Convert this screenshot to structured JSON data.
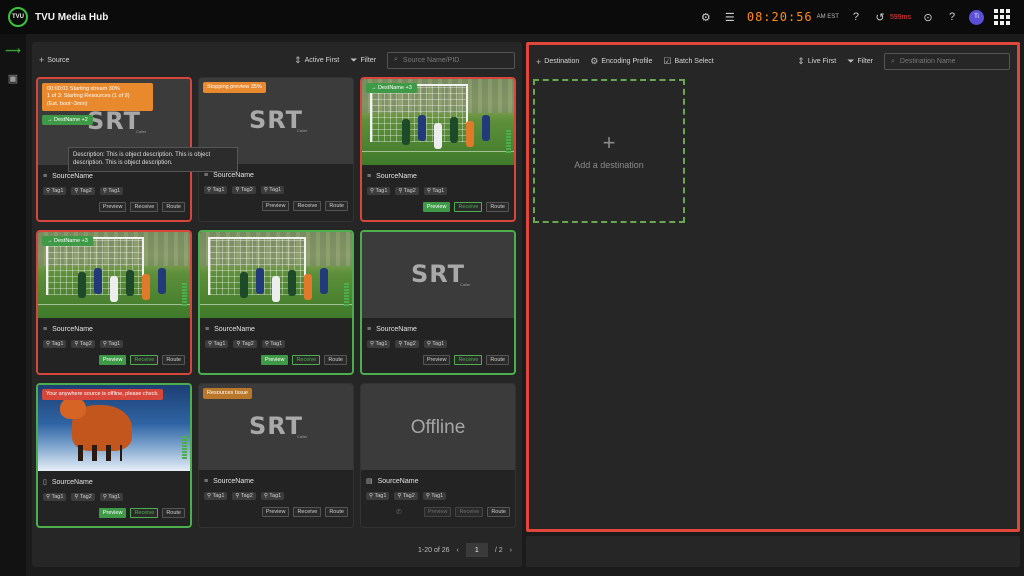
{
  "app": {
    "title": "TVU Media Hub",
    "logo_text": "TVU"
  },
  "topbar": {
    "clock": "08:20:56",
    "timezone": "AM EST",
    "latency": "599ms",
    "user_initials": "Ti",
    "icons": [
      "settings-icon",
      "storage-icon",
      "wifi-icon",
      "history-icon",
      "download-icon",
      "help-icon",
      "avatar",
      "apps-grid-icon"
    ]
  },
  "rail": {
    "items": [
      "routes-icon",
      "calendar-icon"
    ]
  },
  "source_panel": {
    "add_label": "Source",
    "sort_label": "Active First",
    "filter_label": "Filter",
    "search_placeholder": "Source Name/PID",
    "tooltip": "Description: This is object description. This is object description. This is object description.",
    "pagination": {
      "range": "1-20 of 26",
      "page": "1",
      "total": "/ 2"
    },
    "cards": [
      {
        "thumb": "srt",
        "border": "red",
        "badge_lines": [
          "00:00:01 Starting stream 30%",
          "1 of 3: Starting Resources (1 of 9)",
          "(Est. boot~3min)"
        ],
        "dest": "DestName +2",
        "name": "SourceName",
        "name_icon": "list",
        "tags": [
          "Tag1",
          "Tag2",
          "Tag1"
        ],
        "actions": [
          "Preview",
          "Receive",
          "Route"
        ],
        "active": []
      },
      {
        "thumb": "srt",
        "border": "none",
        "badge": "Stopping preview 35%",
        "badge_color": "orange",
        "name": "SourceName",
        "name_icon": "list",
        "tags": [
          "Tag1",
          "Tag2",
          "Tag1"
        ],
        "actions": [
          "Preview",
          "Receive",
          "Route"
        ],
        "active": []
      },
      {
        "thumb": "soccer",
        "border": "red",
        "dest": "DestName +3",
        "name": "SourceName",
        "name_icon": "list",
        "tags": [
          "Tag1",
          "Tag2",
          "Tag1"
        ],
        "actions": [
          "Preview",
          "Receive",
          "Route"
        ],
        "active": [
          "Preview",
          "Receive-outline"
        ]
      },
      {
        "thumb": "soccer",
        "border": "red",
        "dest": "DestName +3",
        "name": "SourceName",
        "name_icon": "list",
        "tags": [
          "Tag1",
          "Tag2",
          "Tag1"
        ],
        "actions": [
          "Preview",
          "Receive",
          "Route"
        ],
        "active": [
          "Preview",
          "Receive-outline"
        ]
      },
      {
        "thumb": "soccer",
        "border": "green",
        "name": "SourceName",
        "name_icon": "list",
        "tags": [
          "Tag1",
          "Tag2",
          "Tag1"
        ],
        "actions": [
          "Preview",
          "Receive",
          "Route"
        ],
        "active": [
          "Preview",
          "Receive-outline"
        ]
      },
      {
        "thumb": "srt",
        "border": "green",
        "name": "SourceName",
        "name_icon": "list",
        "tags": [
          "Tag1",
          "Tag2",
          "Tag1"
        ],
        "actions": [
          "Preview",
          "Receive",
          "Route"
        ],
        "active": [
          "Receive-outline"
        ]
      },
      {
        "thumb": "fox",
        "border": "green",
        "badge": "Your anywhere source is offline, please check.",
        "badge_color": "red",
        "name": "SourceName",
        "name_icon": "phone",
        "tags": [
          "Tag1",
          "Tag2",
          "Tag1"
        ],
        "actions": [
          "Preview",
          "Receive",
          "Route"
        ],
        "active": [
          "Preview",
          "Receive-outline"
        ]
      },
      {
        "thumb": "srt",
        "border": "none",
        "badge": "Resources Issue",
        "badge_color": "tan",
        "name": "SourceName",
        "name_icon": "list",
        "tags": [
          "Tag1",
          "Tag2",
          "Tag1"
        ],
        "actions": [
          "Preview",
          "Receive",
          "Route"
        ],
        "active": []
      },
      {
        "thumb": "offline",
        "offline_text": "Offline",
        "border": "none",
        "name": "SourceName",
        "name_icon": "tablet",
        "tags": [
          "Tag1",
          "Tag2",
          "Tag1"
        ],
        "actions": [
          "Preview",
          "Receive",
          "Route"
        ],
        "active": [
          "dim"
        ],
        "phone": true
      }
    ],
    "srt": {
      "text": "SRT",
      "sub": "Caller"
    }
  },
  "destination_panel": {
    "add_label": "Destination",
    "encoding_label": "Encoding Profile",
    "batch_label": "Batch Select",
    "sort_label": "Live First",
    "filter_label": "Filter",
    "search_placeholder": "Destination Name",
    "add_card_label": "Add a destination"
  }
}
